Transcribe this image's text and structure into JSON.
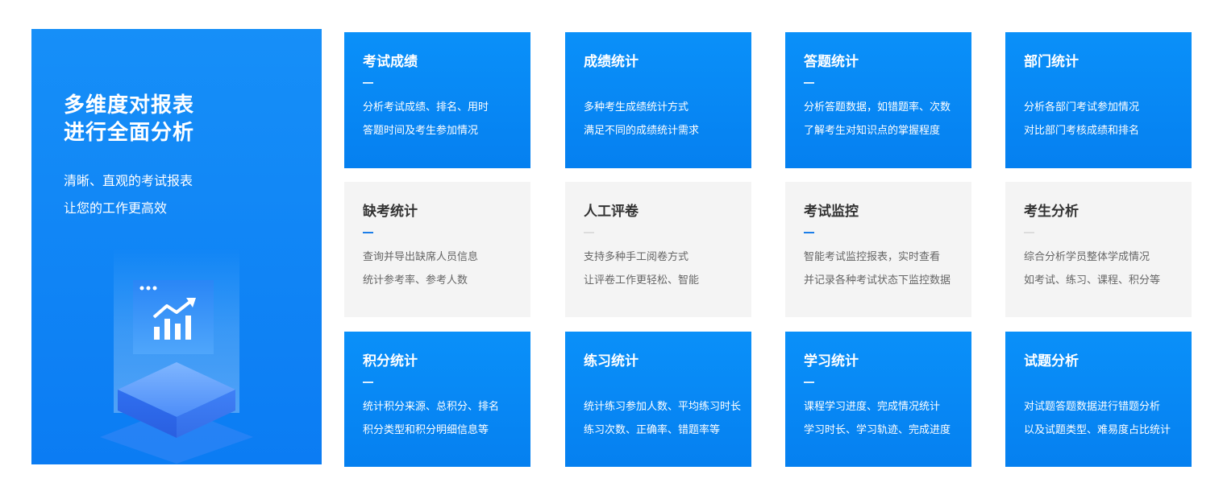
{
  "colors": {
    "accent_blue": "#0a90f9",
    "card_gray": "#f4f4f4",
    "accent_dash": "#1c7ee8"
  },
  "hero": {
    "title_line1": "多维度对报表",
    "title_line2": "进行全面分析",
    "sub_line1": "清晰、直观的考试报表",
    "sub_line2": "让您的工作更高效",
    "illustration_icon": "chart-trend-icon"
  },
  "cards": [
    {
      "title": "考试成绩",
      "line1": "分析考试成绩、排名、用时",
      "line2": "答题时间及考生参加情况"
    },
    {
      "title": "成绩统计",
      "line1": "多种考生成绩统计方式",
      "line2": "满足不同的成绩统计需求"
    },
    {
      "title": "答题统计",
      "line1": "分析答题数据，如错题率、次数",
      "line2": "了解考生对知识点的掌握程度"
    },
    {
      "title": "部门统计",
      "line1": "分析各部门考试参加情况",
      "line2": "对比部门考核成绩和排名"
    },
    {
      "title": "缺考统计",
      "line1": "查询并导出缺席人员信息",
      "line2": "统计参考率、参考人数"
    },
    {
      "title": "人工评卷",
      "line1": "支持多种手工阅卷方式",
      "line2": "让评卷工作更轻松、智能"
    },
    {
      "title": "考试监控",
      "line1": "智能考试监控报表，实时查看",
      "line2": "并记录各种考试状态下监控数据"
    },
    {
      "title": "考生分析",
      "line1": "综合分析学员整体学成情况",
      "line2": "如考试、练习、课程、积分等"
    },
    {
      "title": "积分统计",
      "line1": "统计积分来源、总积分、排名",
      "line2": "积分类型和积分明细信息等"
    },
    {
      "title": "练习统计",
      "line1": "统计练习参加人数、平均练习时长",
      "line2": "练习次数、正确率、错题率等"
    },
    {
      "title": "学习统计",
      "line1": "课程学习进度、完成情况统计",
      "line2": "学习时长、学习轨迹、完成进度"
    },
    {
      "title": "试题分析",
      "line1": "对试题答题数据进行错题分析",
      "line2": "以及试题类型、难易度占比统计"
    }
  ]
}
